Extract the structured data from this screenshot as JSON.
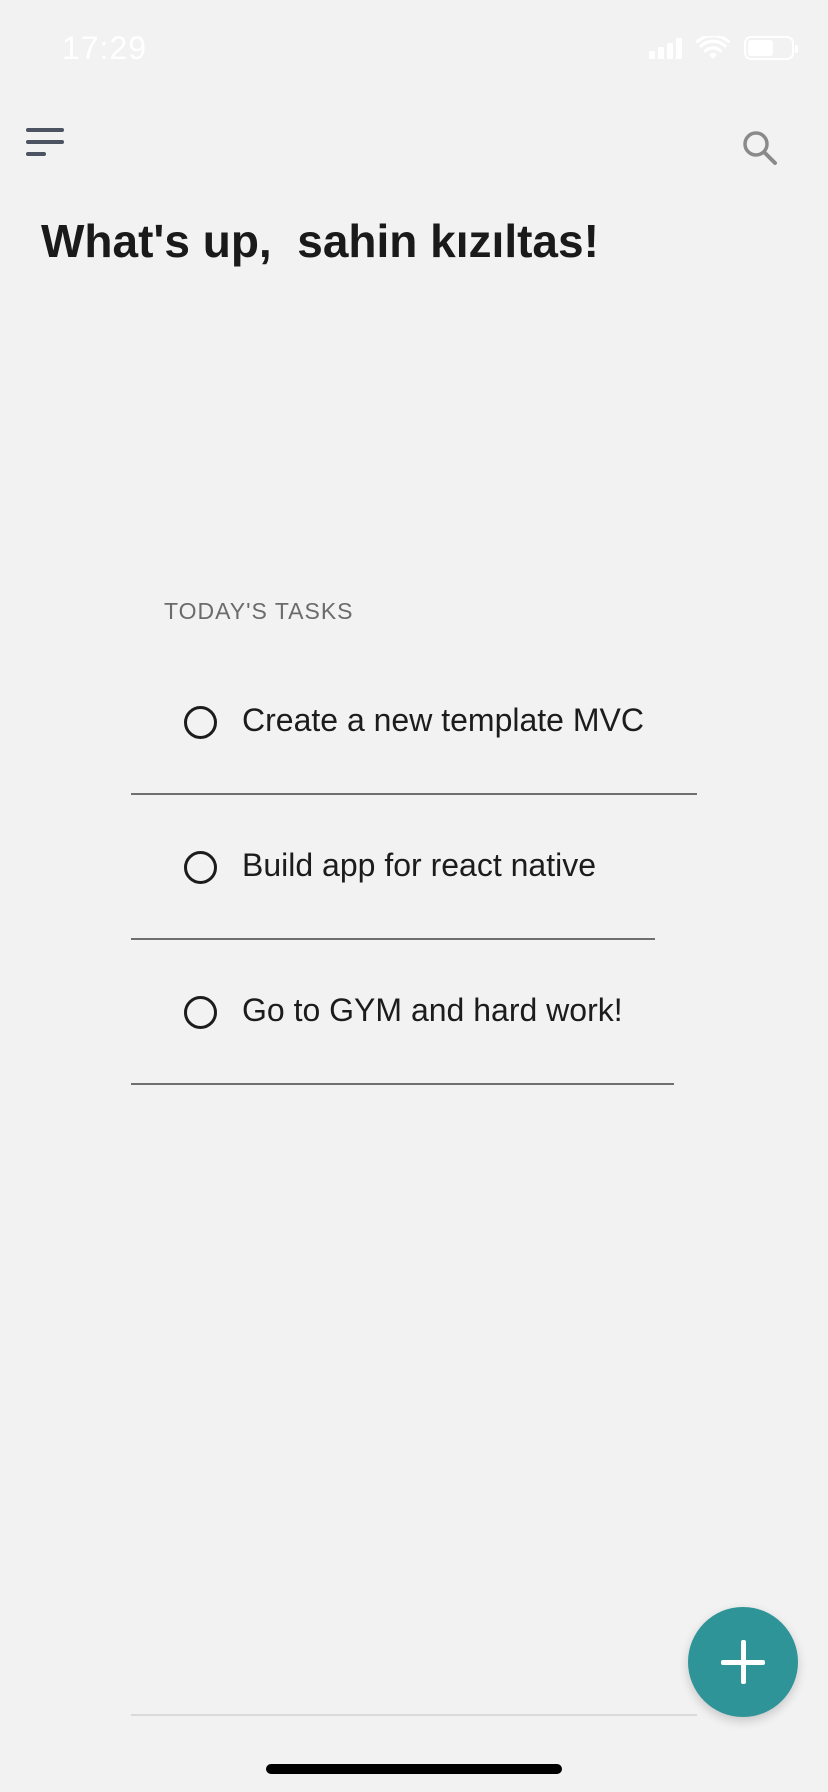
{
  "status_bar": {
    "time": "17:29",
    "signal_icon": "cellular-signal-icon",
    "wifi_icon": "wifi-icon",
    "battery_icon": "battery-icon",
    "battery_level": 0.6
  },
  "header": {
    "menu_icon": "hamburger-menu-icon",
    "search_icon": "search-icon"
  },
  "greeting": "What's up,  sahin kızıltas!",
  "section_label": "TODAY'S TASKS",
  "tasks": [
    {
      "text": "Create a new template MVC",
      "completed": false
    },
    {
      "text": "Build app for react native",
      "completed": false
    },
    {
      "text": "Go to GYM and hard work!",
      "completed": false
    }
  ],
  "fab": {
    "icon": "plus-icon"
  },
  "colors": {
    "background": "#f2f2f2",
    "fab": "#2f9498",
    "text": "#1c1c1c",
    "section_label": "#6b6b6b",
    "menu_icon": "#4c5462",
    "search_icon": "#8a8a8a"
  }
}
